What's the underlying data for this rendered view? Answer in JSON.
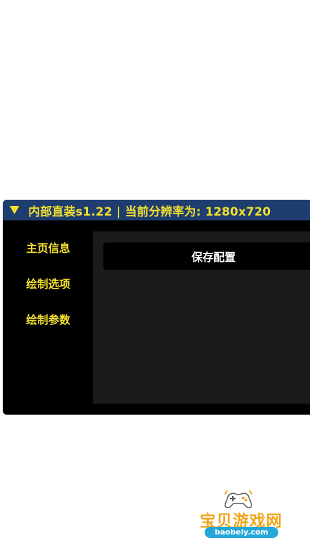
{
  "window": {
    "title": "内部直装s1.22 | 当前分辨率为: 1280x720"
  },
  "sidebar": {
    "items": [
      {
        "label": "主页信息"
      },
      {
        "label": "绘制选项"
      },
      {
        "label": "绘制参数"
      }
    ]
  },
  "main": {
    "save_label": "保存配置"
  },
  "watermark": {
    "brand": "宝贝游戏网",
    "url": "baobeiy.com"
  },
  "colors": {
    "title_bar": "#1f3d6f",
    "menu_text": "#f2df2f",
    "content_bg": "#1b1b1b",
    "button_bg": "#000000"
  },
  "icons": {
    "collapse": "triangle-down-icon",
    "watermark": "gamepad-icon"
  }
}
